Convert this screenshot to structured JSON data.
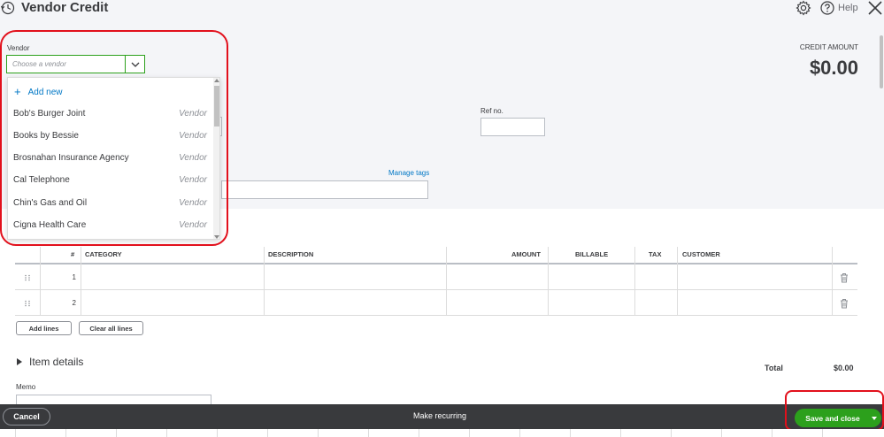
{
  "header": {
    "title": "Vendor Credit",
    "help_label": "Help"
  },
  "vendor": {
    "label": "Vendor",
    "placeholder": "Choose a vendor"
  },
  "credit": {
    "label": "CREDIT AMOUNT",
    "amount": "$0.00"
  },
  "ref_no_label": "Ref no.",
  "manage_tags_label": "Manage tags",
  "dropdown": {
    "add_new_label": "Add new",
    "items": [
      {
        "name": "Bob's Burger Joint",
        "type": "Vendor"
      },
      {
        "name": "Books by Bessie",
        "type": "Vendor"
      },
      {
        "name": "Brosnahan Insurance Agency",
        "type": "Vendor"
      },
      {
        "name": "Cal Telephone",
        "type": "Vendor"
      },
      {
        "name": "Chin's Gas and Oil",
        "type": "Vendor"
      },
      {
        "name": "Cigna Health Care",
        "type": "Vendor"
      }
    ]
  },
  "table": {
    "columns": {
      "num": "#",
      "category": "CATEGORY",
      "description": "DESCRIPTION",
      "amount": "AMOUNT",
      "billable": "BILLABLE",
      "tax": "TAX",
      "customer": "CUSTOMER"
    },
    "rows": [
      {
        "num": "1"
      },
      {
        "num": "2"
      }
    ]
  },
  "buttons": {
    "add_lines": "Add lines",
    "clear_all_lines": "Clear all lines"
  },
  "item_details_label": "Item details",
  "totals": {
    "label": "Total",
    "value": "$0.00"
  },
  "memo_label": "Memo",
  "footer": {
    "cancel": "Cancel",
    "make_recurring": "Make recurring",
    "save_and_close": "Save and close"
  },
  "colors": {
    "accent_green": "#2ca01c",
    "link_blue": "#0077c5",
    "highlight_red": "#e2101c",
    "footer_bg": "#393a3d"
  }
}
